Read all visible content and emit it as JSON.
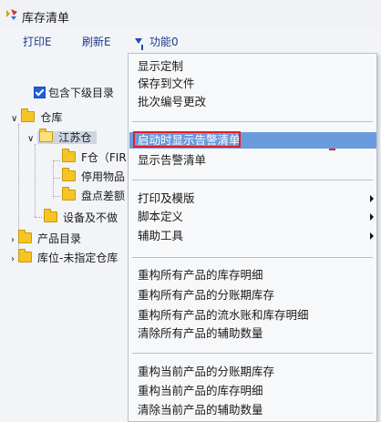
{
  "window": {
    "title": "库存清单"
  },
  "toolbar": {
    "print": "打印E",
    "refresh": "刷新E",
    "function": "功能0"
  },
  "panel": {
    "include_sublevels": "包含下级目录",
    "tree": {
      "warehouse": "仓库",
      "jiangsu": "江苏仓",
      "f_warehouse": "F仓（FIR",
      "discontinued": "停用物品",
      "inventory_diff": "盘点差额",
      "equipment": "设备及不做",
      "product_catalog": "产品目录",
      "unassigned_location": "库位-未指定仓库"
    }
  },
  "menu": {
    "items": {
      "display_custom": "显示定制",
      "save_to_file": "保存到文件",
      "batch_change": "批次编号更改",
      "show_alert_on_start": "启动时显示告警清单",
      "show_alert": "显示告警清单",
      "print_template": "打印及模版",
      "script_define": "脚本定义",
      "aux_tools": "辅助工具",
      "rebuild_all_stock": "重构所有产品的库存明细",
      "rebuild_all_ledger": "重构所有产品的分账期库存",
      "rebuild_all_flow": "重构所有产品的流水账和库存明细",
      "clear_all_aux": "清除所有产品的辅助数量",
      "rebuild_cur_ledger": "重构当前产品的分账期库存",
      "rebuild_cur_stock": "重构当前产品的库存明细",
      "clear_cur_aux": "清除当前产品的辅助数量"
    }
  },
  "colors": {
    "highlight": "#6a9bdc",
    "annotation_red": "#e0202a",
    "folder": "#f5c425",
    "link_blue": "#1f3a8a"
  }
}
